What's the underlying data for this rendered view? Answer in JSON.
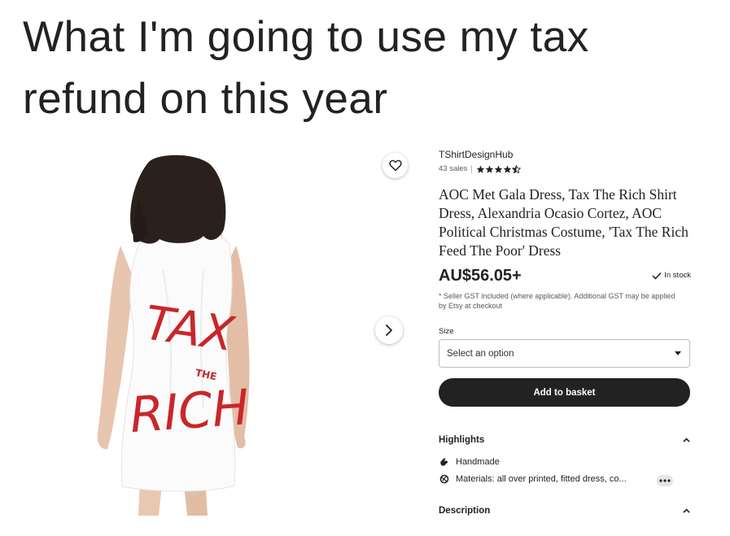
{
  "meme": {
    "caption": "What I'm going to use my tax refund on this year"
  },
  "product_image": {
    "print_text_1": "TAX",
    "print_text_2": "THE",
    "print_text_3": "RICH"
  },
  "listing": {
    "shop_name": "TShirtDesignHub",
    "sales": "43 sales",
    "rating_stars": 4.5,
    "title": "AOC Met Gala Dress, Tax The Rich Shirt Dress, Alexandria Ocasio Cortez, AOC Political Christmas Costume, 'Tax The Rich Feed The Poor' Dress",
    "price": "AU$56.05+",
    "stock": "In stock",
    "tax_note": "* Seller GST included (where applicable). Additional GST may be applied by Etsy at checkout",
    "size_label": "Size",
    "size_placeholder": "Select an option",
    "add_button": "Add to basket",
    "highlights_title": "Highlights",
    "highlights": [
      {
        "icon": "hand-icon",
        "text": "Handmade"
      },
      {
        "icon": "materials-icon",
        "text": "Materials: all over printed, fitted dress, co..."
      }
    ],
    "description_title": "Description"
  },
  "colors": {
    "text": "#222222",
    "button": "#222222",
    "print_red": "#c8262b"
  }
}
